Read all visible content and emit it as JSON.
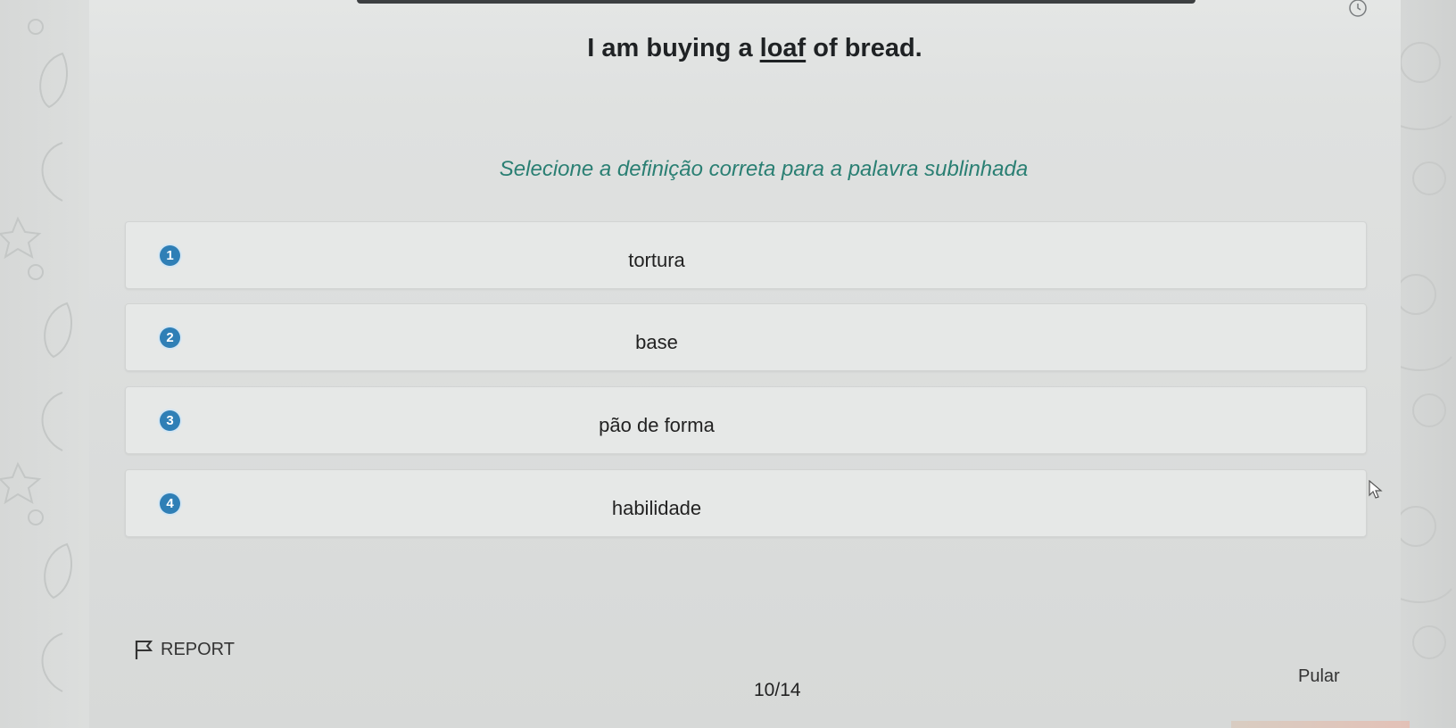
{
  "question": {
    "sentence_before": "I am buying a ",
    "sentence_target": "loaf",
    "sentence_after": " of bread.",
    "instruction": "Selecione a definição correta para a palavra sublinhada"
  },
  "options": [
    {
      "number": "1",
      "label": "tortura"
    },
    {
      "number": "2",
      "label": "base"
    },
    {
      "number": "3",
      "label": "pão de forma"
    },
    {
      "number": "4",
      "label": "habilidade"
    }
  ],
  "footer": {
    "report_label": "REPORT",
    "progress": "10/14",
    "skip_label": "Pular"
  },
  "colors": {
    "accent": "#2a7f73",
    "number_badge": "#2f7fb6"
  },
  "icons": {
    "timer": "timer-icon",
    "report": "flag-icon",
    "cursor": "mouse-pointer-icon"
  }
}
